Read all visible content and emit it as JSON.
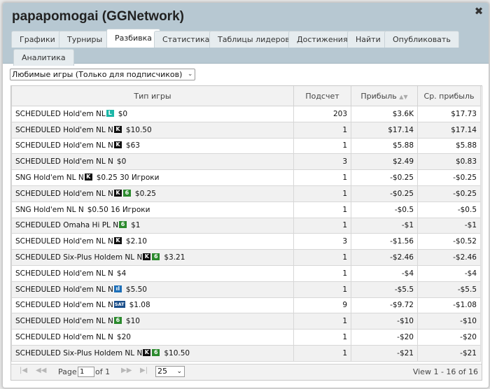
{
  "window": {
    "title": "papapomogai (GGNetwork)",
    "close_glyph": "✖"
  },
  "tabs": [
    {
      "label": "Графики",
      "active": false
    },
    {
      "label": "Турниры",
      "active": false
    },
    {
      "label": "Разбивка",
      "active": true
    },
    {
      "label": "Статистика",
      "active": false
    },
    {
      "label": "Таблицы лидеров",
      "active": false
    },
    {
      "label": "Достижения",
      "active": false
    },
    {
      "label": "Найти",
      "active": false
    },
    {
      "label": "Опубликовать",
      "active": false
    },
    {
      "label": "Аналитика",
      "active": false
    }
  ],
  "filter": {
    "selected": "Любимые игры (Только для подписчиков)",
    "chevron": "⌄"
  },
  "table": {
    "headers": {
      "game_type": "Тип игры",
      "count": "Подсчет",
      "profit": "Прибыль",
      "avg_profit": "Ср. прибыль"
    },
    "sort_icon": "▲▼",
    "rows": [
      {
        "game": "SCHEDULED Hold'em NL",
        "badges": [
          {
            "text": "L",
            "kind": "L"
          }
        ],
        "stake": "$0",
        "count": "203",
        "profit": "$3.6K",
        "avg": "$17.73",
        "negative": false
      },
      {
        "game": "SCHEDULED Hold'em NL N",
        "badges": [
          {
            "text": "K",
            "kind": "K"
          }
        ],
        "stake": "$10.50",
        "count": "1",
        "profit": "$17.14",
        "avg": "$17.14",
        "negative": false
      },
      {
        "game": "SCHEDULED Hold'em NL N",
        "badges": [
          {
            "text": "K",
            "kind": "K"
          }
        ],
        "stake": "$63",
        "count": "1",
        "profit": "$5.88",
        "avg": "$5.88",
        "negative": false
      },
      {
        "game": "SCHEDULED Hold'em NL N",
        "badges": [],
        "stake": "$0",
        "count": "3",
        "profit": "$2.49",
        "avg": "$0.83",
        "negative": false
      },
      {
        "game": "SNG Hold'em NL N",
        "badges": [
          {
            "text": "K",
            "kind": "K"
          }
        ],
        "stake": "$0.25 30 Игроки",
        "count": "1",
        "profit": "-$0.25",
        "avg": "-$0.25",
        "negative": true
      },
      {
        "game": "SCHEDULED Hold'em NL N",
        "badges": [
          {
            "text": "K",
            "kind": "K"
          },
          {
            "text": "6",
            "kind": "6"
          }
        ],
        "stake": "$0.25",
        "count": "1",
        "profit": "-$0.25",
        "avg": "-$0.25",
        "negative": true
      },
      {
        "game": "SNG Hold'em NL N",
        "badges": [],
        "stake": "$0.50 16 Игроки",
        "count": "1",
        "profit": "-$0.5",
        "avg": "-$0.5",
        "negative": true
      },
      {
        "game": "SCHEDULED Omaha Hi PL N",
        "badges": [
          {
            "text": "6",
            "kind": "6"
          }
        ],
        "stake": "$1",
        "count": "1",
        "profit": "-$1",
        "avg": "-$1",
        "negative": true
      },
      {
        "game": "SCHEDULED Hold'em NL N",
        "badges": [
          {
            "text": "K",
            "kind": "K"
          }
        ],
        "stake": "$2.10",
        "count": "3",
        "profit": "-$1.56",
        "avg": "-$0.52",
        "negative": true
      },
      {
        "game": "SCHEDULED Six-Plus Holdem NL N",
        "badges": [
          {
            "text": "K",
            "kind": "K"
          },
          {
            "text": "6",
            "kind": "6"
          }
        ],
        "stake": "$3.21",
        "count": "1",
        "profit": "-$2.46",
        "avg": "-$2.46",
        "negative": true
      },
      {
        "game": "SCHEDULED Hold'em NL N",
        "badges": [],
        "stake": "$4",
        "count": "1",
        "profit": "-$4",
        "avg": "-$4",
        "negative": true
      },
      {
        "game": "SCHEDULED Hold'em NL N",
        "badges": [
          {
            "text": "ıl",
            "kind": "t"
          }
        ],
        "stake": "$5.50",
        "count": "1",
        "profit": "-$5.5",
        "avg": "-$5.5",
        "negative": true
      },
      {
        "game": "SCHEDULED Hold'em NL N",
        "badges": [
          {
            "text": "SAT",
            "kind": "SAT"
          }
        ],
        "stake": "$1.08",
        "count": "9",
        "profit": "-$9.72",
        "avg": "-$1.08",
        "negative": true
      },
      {
        "game": "SCHEDULED Hold'em NL N",
        "badges": [
          {
            "text": "6",
            "kind": "6"
          }
        ],
        "stake": "$10",
        "count": "1",
        "profit": "-$10",
        "avg": "-$10",
        "negative": true
      },
      {
        "game": "SCHEDULED Hold'em NL N",
        "badges": [],
        "stake": "$20",
        "count": "1",
        "profit": "-$20",
        "avg": "-$20",
        "negative": true
      },
      {
        "game": "SCHEDULED Six-Plus Holdem NL N",
        "badges": [
          {
            "text": "K",
            "kind": "K"
          },
          {
            "text": "6",
            "kind": "6"
          }
        ],
        "stake": "$10.50",
        "count": "1",
        "profit": "-$21",
        "avg": "-$21",
        "negative": true
      }
    ]
  },
  "pager": {
    "first": "|◀",
    "prev": "◀◀",
    "page_label": "Page",
    "page_value": "1",
    "of_label": "of 1",
    "next": "▶▶",
    "last": "▶|",
    "rows_per_page": "25",
    "rows_chevron": "⌄",
    "view_info": "View 1 - 16 of 16"
  },
  "colors": {
    "header_bg": "#b7c8d2",
    "negative": "#b4443c"
  }
}
